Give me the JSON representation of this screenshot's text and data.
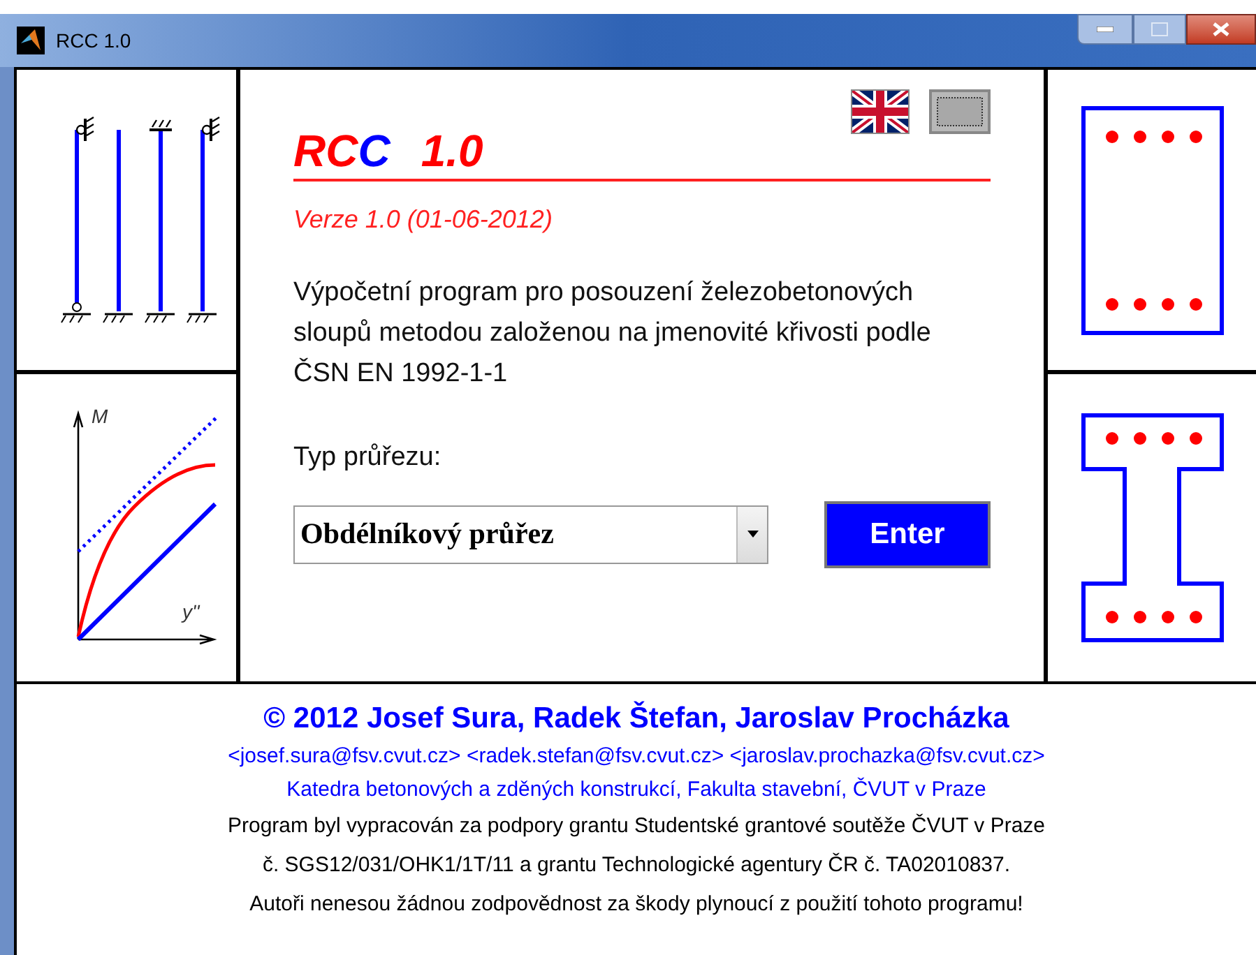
{
  "window": {
    "title": "RCC 1.0"
  },
  "logo": [
    {
      "text": "RC",
      "color": "#ff0000"
    },
    {
      "text": "C",
      "color": "#0000ff"
    },
    {
      "text": "1.0",
      "color": "#ff0000"
    }
  ],
  "version": "Verze 1.0  (01-06-2012)",
  "description": "Výpočetní program pro posouzení železobetonových sloupů metodou založenou na jmenovité křivosti podle ČSN EN 1992-1-1",
  "section_label": "Typ průřezu:",
  "section_select": {
    "value": "Obdélníkový průřez"
  },
  "enter_button": "Enter",
  "chart_labels": {
    "y": "M",
    "x": "y''"
  },
  "footer": [
    {
      "kind": "authors",
      "text": "©  2012  Josef Sura,  Radek Štefan,  Jaroslav Procházka"
    },
    {
      "kind": "contact",
      "text": "<josef.sura@fsv.cvut.cz> <radek.stefan@fsv.cvut.cz> <jaroslav.prochazka@fsv.cvut.cz>"
    },
    {
      "kind": "contact",
      "text": "Katedra betonových a zděných konstrukcí, Fakulta stavební, ČVUT v Praze"
    },
    {
      "kind": "note",
      "text": "Program byl vypracován za podpory grantu Studentské grantové soutěže ČVUT v Praze"
    },
    {
      "kind": "note",
      "text": "č. SGS12/031/OHK1/1T/11 a grantu Technologické agentury ČR č. TA02010837."
    },
    {
      "kind": "note",
      "text": "Autoři nenesou žádnou zodpovědnost za škody plynoucí z použití tohoto programu!"
    }
  ]
}
